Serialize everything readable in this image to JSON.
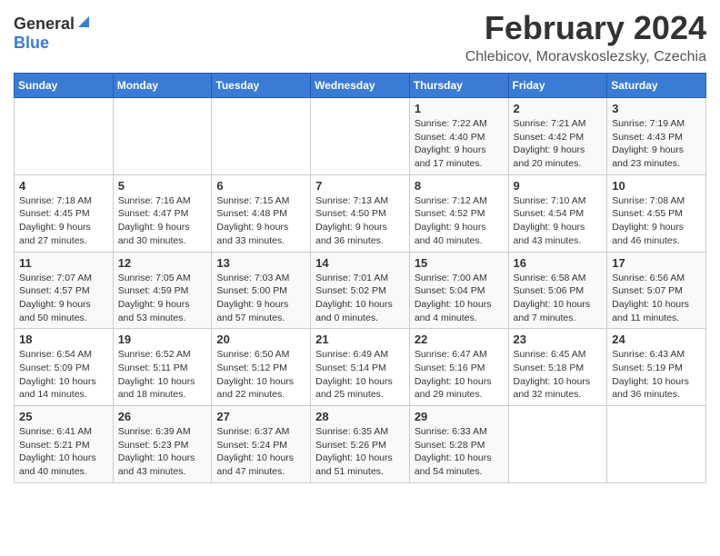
{
  "header": {
    "logo_general": "General",
    "logo_blue": "Blue",
    "month_title": "February 2024",
    "location": "Chlebicov, Moravskoslezsky, Czechia"
  },
  "weekdays": [
    "Sunday",
    "Monday",
    "Tuesday",
    "Wednesday",
    "Thursday",
    "Friday",
    "Saturday"
  ],
  "weeks": [
    [
      {
        "day": "",
        "info": ""
      },
      {
        "day": "",
        "info": ""
      },
      {
        "day": "",
        "info": ""
      },
      {
        "day": "",
        "info": ""
      },
      {
        "day": "1",
        "info": "Sunrise: 7:22 AM\nSunset: 4:40 PM\nDaylight: 9 hours\nand 17 minutes."
      },
      {
        "day": "2",
        "info": "Sunrise: 7:21 AM\nSunset: 4:42 PM\nDaylight: 9 hours\nand 20 minutes."
      },
      {
        "day": "3",
        "info": "Sunrise: 7:19 AM\nSunset: 4:43 PM\nDaylight: 9 hours\nand 23 minutes."
      }
    ],
    [
      {
        "day": "4",
        "info": "Sunrise: 7:18 AM\nSunset: 4:45 PM\nDaylight: 9 hours\nand 27 minutes."
      },
      {
        "day": "5",
        "info": "Sunrise: 7:16 AM\nSunset: 4:47 PM\nDaylight: 9 hours\nand 30 minutes."
      },
      {
        "day": "6",
        "info": "Sunrise: 7:15 AM\nSunset: 4:48 PM\nDaylight: 9 hours\nand 33 minutes."
      },
      {
        "day": "7",
        "info": "Sunrise: 7:13 AM\nSunset: 4:50 PM\nDaylight: 9 hours\nand 36 minutes."
      },
      {
        "day": "8",
        "info": "Sunrise: 7:12 AM\nSunset: 4:52 PM\nDaylight: 9 hours\nand 40 minutes."
      },
      {
        "day": "9",
        "info": "Sunrise: 7:10 AM\nSunset: 4:54 PM\nDaylight: 9 hours\nand 43 minutes."
      },
      {
        "day": "10",
        "info": "Sunrise: 7:08 AM\nSunset: 4:55 PM\nDaylight: 9 hours\nand 46 minutes."
      }
    ],
    [
      {
        "day": "11",
        "info": "Sunrise: 7:07 AM\nSunset: 4:57 PM\nDaylight: 9 hours\nand 50 minutes."
      },
      {
        "day": "12",
        "info": "Sunrise: 7:05 AM\nSunset: 4:59 PM\nDaylight: 9 hours\nand 53 minutes."
      },
      {
        "day": "13",
        "info": "Sunrise: 7:03 AM\nSunset: 5:00 PM\nDaylight: 9 hours\nand 57 minutes."
      },
      {
        "day": "14",
        "info": "Sunrise: 7:01 AM\nSunset: 5:02 PM\nDaylight: 10 hours\nand 0 minutes."
      },
      {
        "day": "15",
        "info": "Sunrise: 7:00 AM\nSunset: 5:04 PM\nDaylight: 10 hours\nand 4 minutes."
      },
      {
        "day": "16",
        "info": "Sunrise: 6:58 AM\nSunset: 5:06 PM\nDaylight: 10 hours\nand 7 minutes."
      },
      {
        "day": "17",
        "info": "Sunrise: 6:56 AM\nSunset: 5:07 PM\nDaylight: 10 hours\nand 11 minutes."
      }
    ],
    [
      {
        "day": "18",
        "info": "Sunrise: 6:54 AM\nSunset: 5:09 PM\nDaylight: 10 hours\nand 14 minutes."
      },
      {
        "day": "19",
        "info": "Sunrise: 6:52 AM\nSunset: 5:11 PM\nDaylight: 10 hours\nand 18 minutes."
      },
      {
        "day": "20",
        "info": "Sunrise: 6:50 AM\nSunset: 5:12 PM\nDaylight: 10 hours\nand 22 minutes."
      },
      {
        "day": "21",
        "info": "Sunrise: 6:49 AM\nSunset: 5:14 PM\nDaylight: 10 hours\nand 25 minutes."
      },
      {
        "day": "22",
        "info": "Sunrise: 6:47 AM\nSunset: 5:16 PM\nDaylight: 10 hours\nand 29 minutes."
      },
      {
        "day": "23",
        "info": "Sunrise: 6:45 AM\nSunset: 5:18 PM\nDaylight: 10 hours\nand 32 minutes."
      },
      {
        "day": "24",
        "info": "Sunrise: 6:43 AM\nSunset: 5:19 PM\nDaylight: 10 hours\nand 36 minutes."
      }
    ],
    [
      {
        "day": "25",
        "info": "Sunrise: 6:41 AM\nSunset: 5:21 PM\nDaylight: 10 hours\nand 40 minutes."
      },
      {
        "day": "26",
        "info": "Sunrise: 6:39 AM\nSunset: 5:23 PM\nDaylight: 10 hours\nand 43 minutes."
      },
      {
        "day": "27",
        "info": "Sunrise: 6:37 AM\nSunset: 5:24 PM\nDaylight: 10 hours\nand 47 minutes."
      },
      {
        "day": "28",
        "info": "Sunrise: 6:35 AM\nSunset: 5:26 PM\nDaylight: 10 hours\nand 51 minutes."
      },
      {
        "day": "29",
        "info": "Sunrise: 6:33 AM\nSunset: 5:28 PM\nDaylight: 10 hours\nand 54 minutes."
      },
      {
        "day": "",
        "info": ""
      },
      {
        "day": "",
        "info": ""
      }
    ]
  ]
}
